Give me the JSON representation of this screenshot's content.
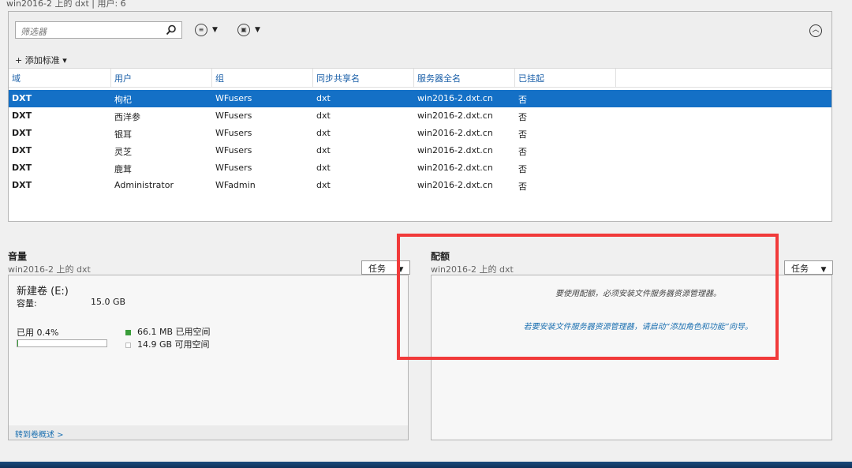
{
  "header": {
    "title": "win2016-2 上的 dxt | 用户: 6"
  },
  "filter": {
    "placeholder": "筛选器",
    "add_criteria": "+ 添加标准 ▾"
  },
  "columns": [
    "域",
    "用户",
    "组",
    "同步共享名",
    "服务器全名",
    "已挂起"
  ],
  "rows": [
    [
      "DXT",
      "枸杞",
      "WFusers",
      "dxt",
      "win2016-2.dxt.cn",
      "否"
    ],
    [
      "DXT",
      "西洋参",
      "WFusers",
      "dxt",
      "win2016-2.dxt.cn",
      "否"
    ],
    [
      "DXT",
      "银耳",
      "WFusers",
      "dxt",
      "win2016-2.dxt.cn",
      "否"
    ],
    [
      "DXT",
      "灵芝",
      "WFusers",
      "dxt",
      "win2016-2.dxt.cn",
      "否"
    ],
    [
      "DXT",
      "鹿茸",
      "WFusers",
      "dxt",
      "win2016-2.dxt.cn",
      "否"
    ],
    [
      "DXT",
      "Administrator",
      "WFadmin",
      "dxt",
      "win2016-2.dxt.cn",
      "否"
    ]
  ],
  "selected_row": 0,
  "volume": {
    "title": "音量",
    "subtitle": "win2016-2 上的 dxt",
    "task_label": "任务",
    "name": "新建卷 (E:)",
    "capacity_label": "容量:",
    "capacity_value": "15.0 GB",
    "used_label": "已用 0.4%",
    "used_fraction": 0.004,
    "used_space": "66.1 MB 已用空间",
    "free_space": "14.9 GB 可用空间",
    "goto_link": "转到卷概述 >",
    "used_color": "#3a9d3a"
  },
  "quota": {
    "title": "配额",
    "subtitle": "win2016-2 上的 dxt",
    "task_label": "任务",
    "message": "要使用配额，必须安装文件服务器资源管理器。",
    "link": "若要安装文件服务器资源管理器，请启动“添加角色和功能”向导。"
  },
  "colors": {
    "selection": "#1470c6",
    "highlight": "#f13a3a",
    "link": "#1a6fb0"
  }
}
